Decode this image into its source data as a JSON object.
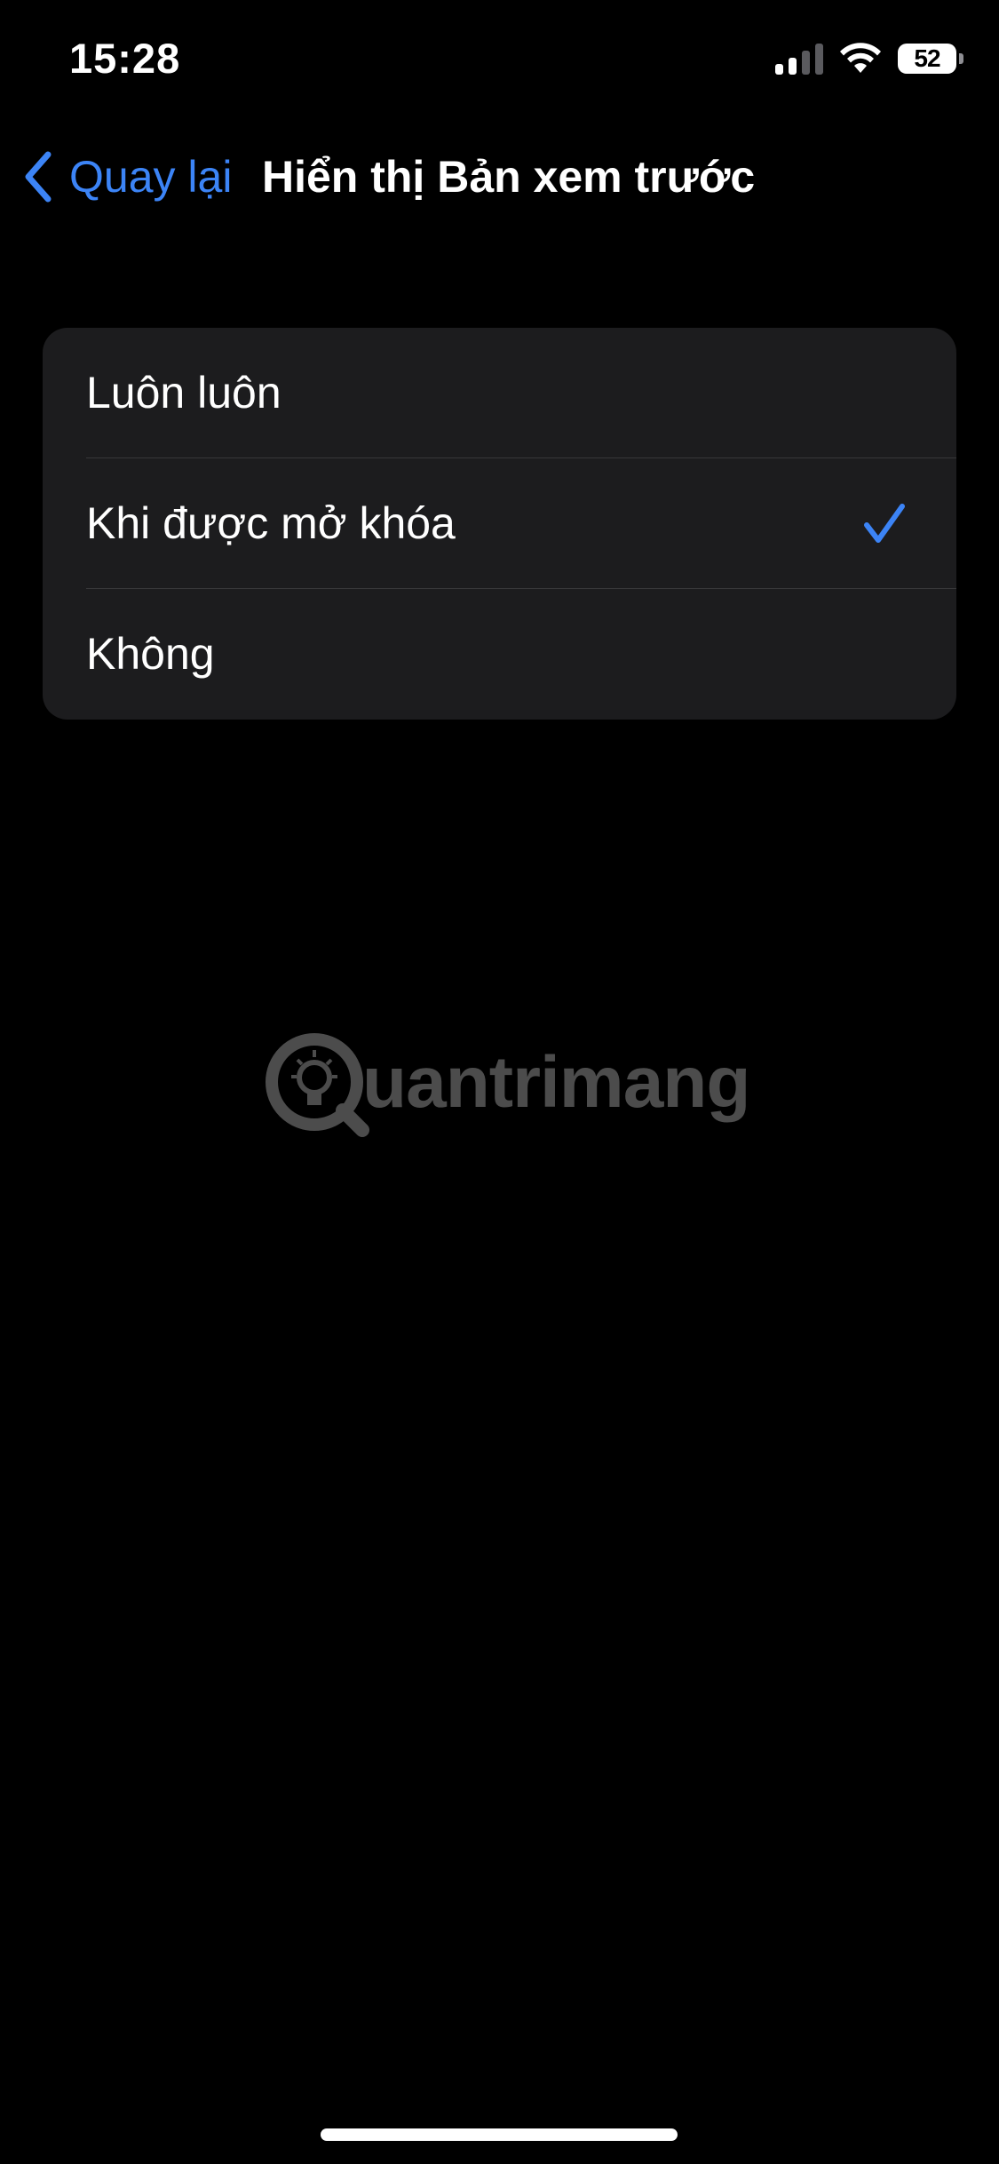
{
  "status_bar": {
    "time": "15:28",
    "battery": "52",
    "icons": [
      "cellular-signal-icon",
      "wifi-icon",
      "battery-icon"
    ]
  },
  "nav": {
    "back_label": "Quay lại",
    "title": "Hiển thị Bản xem trước"
  },
  "options": [
    {
      "label": "Luôn luôn",
      "selected": false
    },
    {
      "label": "Khi được mở khóa",
      "selected": true
    },
    {
      "label": "Không",
      "selected": false
    }
  ],
  "watermark": {
    "text": "uantrimang"
  },
  "colors": {
    "accent": "#3c84f6",
    "background": "#000000",
    "group_background": "#1c1c1e",
    "separator": "#38383a"
  }
}
